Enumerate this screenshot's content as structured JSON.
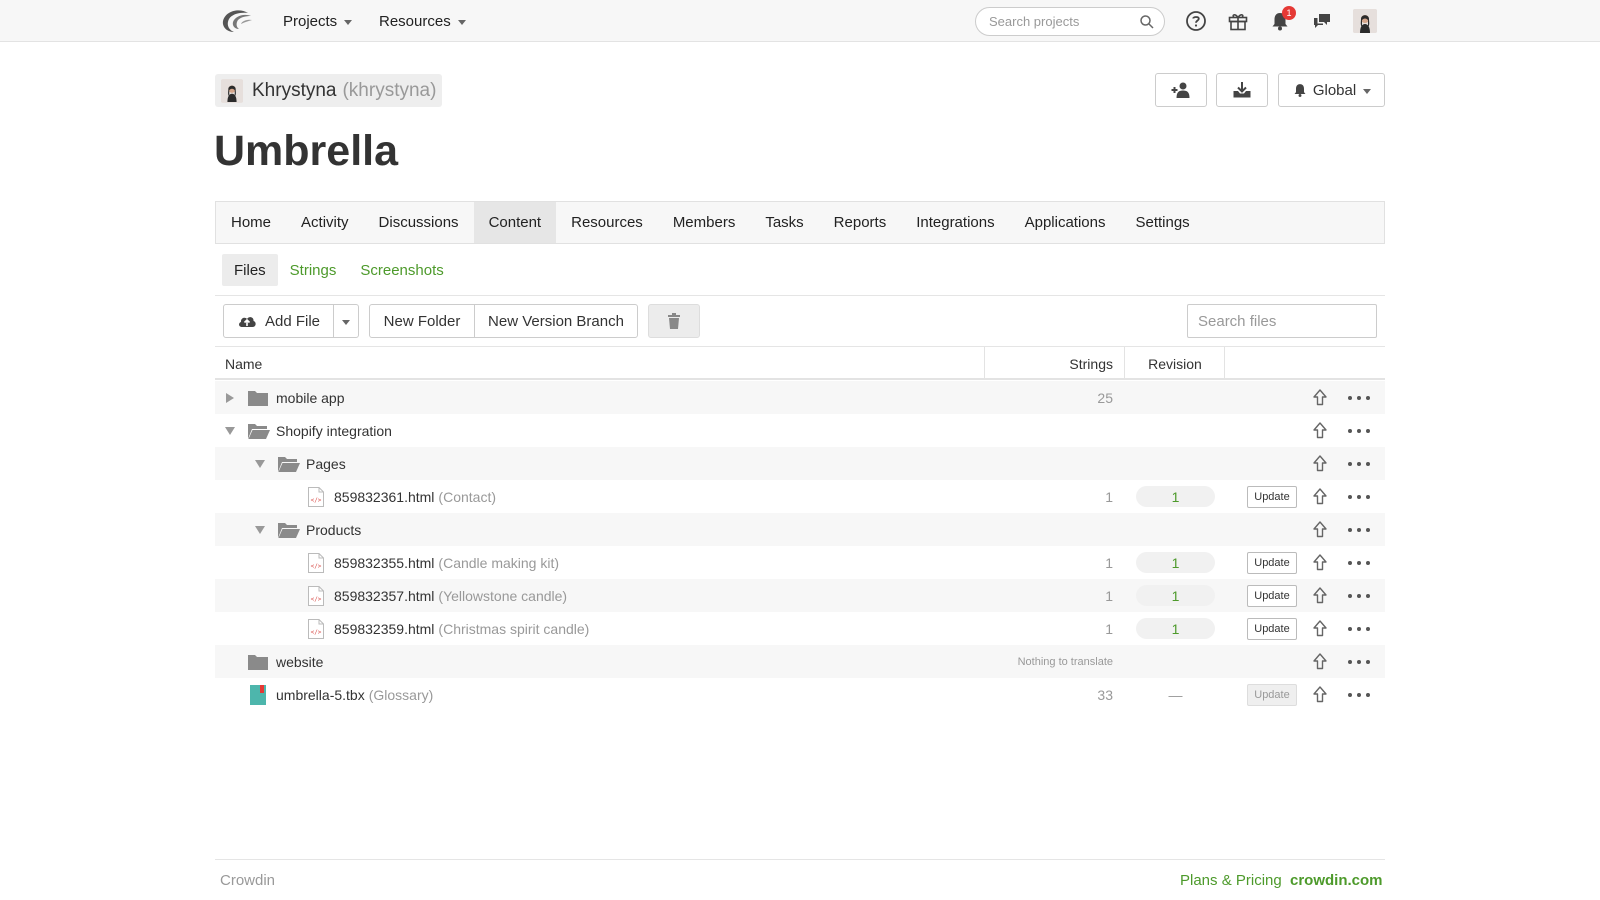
{
  "topbar": {
    "nav": [
      "Projects",
      "Resources"
    ],
    "search_placeholder": "Search projects",
    "notification_count": "1"
  },
  "project": {
    "owner_name": "Khrystyna",
    "owner_handle": "(khrystyna)",
    "title": "Umbrella",
    "notify_label": "Global"
  },
  "tabs": [
    "Home",
    "Activity",
    "Discussions",
    "Content",
    "Resources",
    "Members",
    "Tasks",
    "Reports",
    "Integrations",
    "Applications",
    "Settings"
  ],
  "active_tab": "Content",
  "subtabs": [
    "Files",
    "Strings",
    "Screenshots"
  ],
  "toolbar": {
    "add_file": "Add File",
    "new_folder": "New Folder",
    "new_version_branch": "New Version Branch",
    "search_placeholder": "Search files"
  },
  "table": {
    "headers": {
      "name": "Name",
      "strings": "Strings",
      "revision": "Revision"
    },
    "rows": [
      {
        "type": "folder",
        "expand": "collapsed",
        "depth": 0,
        "name": "mobile app",
        "strings": "25"
      },
      {
        "type": "folder",
        "expand": "expanded",
        "depth": 0,
        "name": "Shopify integration"
      },
      {
        "type": "folder",
        "expand": "expanded",
        "depth": 1,
        "name": "Pages"
      },
      {
        "type": "file",
        "depth": 2,
        "name": "859832361.html",
        "title": "(Contact)",
        "strings": "1",
        "revision": "1",
        "update": "Update"
      },
      {
        "type": "folder",
        "expand": "expanded",
        "depth": 1,
        "name": "Products"
      },
      {
        "type": "file",
        "depth": 2,
        "name": "859832355.html",
        "title": "(Candle making kit)",
        "strings": "1",
        "revision": "1",
        "update": "Update"
      },
      {
        "type": "file",
        "depth": 2,
        "name": "859832357.html",
        "title": "(Yellowstone candle)",
        "strings": "1",
        "revision": "1",
        "update": "Update"
      },
      {
        "type": "file",
        "depth": 2,
        "name": "859832359.html",
        "title": "(Christmas spirit candle)",
        "strings": "1",
        "revision": "1",
        "update": "Update"
      },
      {
        "type": "folder",
        "expand": "none",
        "depth": 0,
        "name": "website",
        "note": "Nothing to translate"
      },
      {
        "type": "glossary",
        "depth": 0,
        "name": "umbrella-5.tbx",
        "title": "(Glossary)",
        "strings": "33",
        "revision": "—",
        "update": "Update"
      }
    ]
  },
  "footer": {
    "brand": "Crowdin",
    "plans": "Plans & Pricing",
    "site": "crowdin.com"
  },
  "colors": {
    "accent_green": "#4d9a2b",
    "badge_red": "#e53935",
    "folder_gray": "#8a8a8a",
    "glossary_teal": "#4db6ac"
  }
}
